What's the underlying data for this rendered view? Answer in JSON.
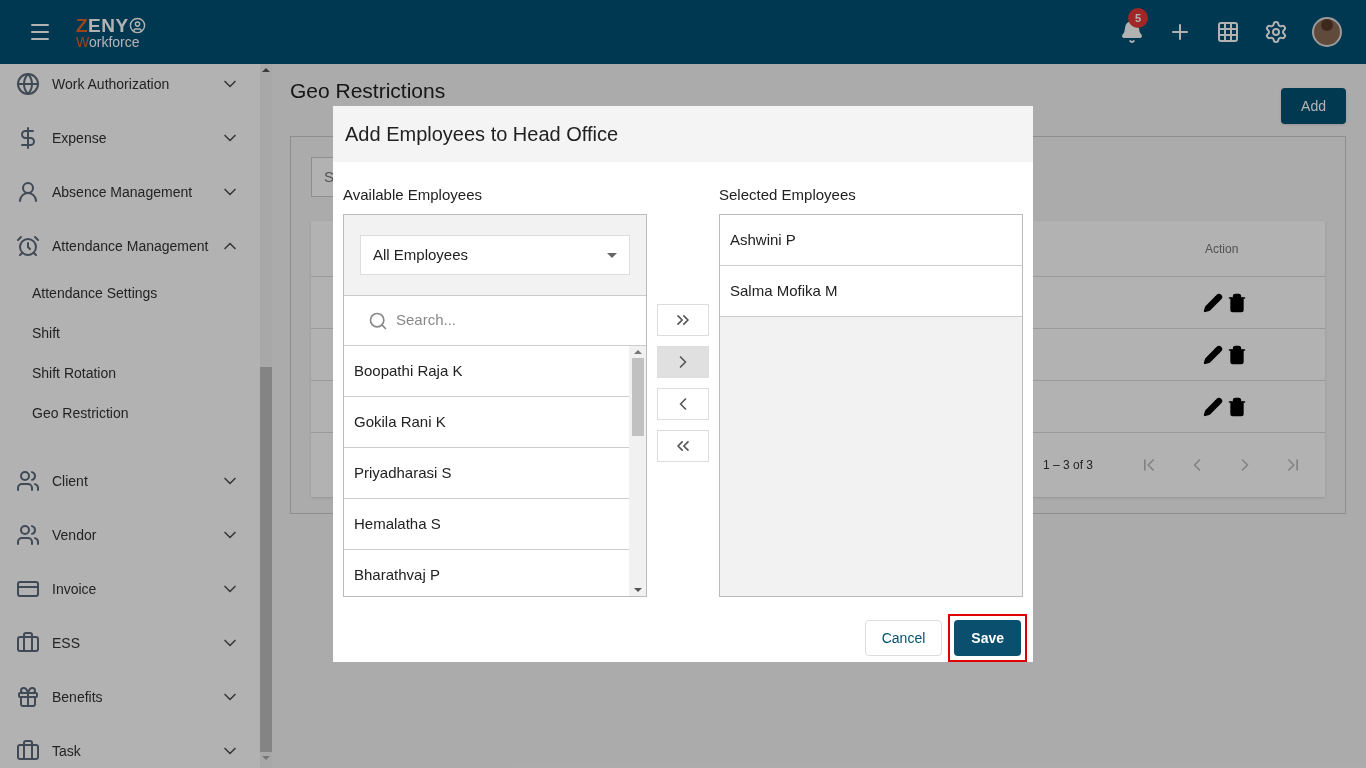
{
  "header": {
    "logo": {
      "mark": "ZENY",
      "sub": "Workforce"
    },
    "notifications": {
      "count": "5"
    }
  },
  "sidebar": {
    "items": [
      {
        "label": "Work Authorization",
        "expanded": false
      },
      {
        "label": "Expense",
        "expanded": false
      },
      {
        "label": "Absence Management",
        "expanded": false
      },
      {
        "label": "Attendance Management",
        "expanded": true,
        "children": [
          {
            "label": "Attendance Settings"
          },
          {
            "label": "Shift"
          },
          {
            "label": "Shift Rotation"
          },
          {
            "label": "Geo Restriction"
          }
        ]
      },
      {
        "label": "Client",
        "expanded": false
      },
      {
        "label": "Vendor",
        "expanded": false
      },
      {
        "label": "Invoice",
        "expanded": false
      },
      {
        "label": "ESS",
        "expanded": false
      },
      {
        "label": "Benefits",
        "expanded": false
      },
      {
        "label": "Task",
        "expanded": false
      }
    ]
  },
  "page": {
    "title": "Geo Restrictions",
    "add_button": "Add",
    "search": {
      "placeholder": "S"
    },
    "table": {
      "columns": [
        "Action"
      ],
      "rows": [
        {
          "editable": true,
          "deletable": true
        },
        {
          "editable": true,
          "deletable": true
        },
        {
          "editable": true,
          "deletable": true
        }
      ],
      "range": "1 – 3 of 3"
    }
  },
  "dialog": {
    "title": "Add Employees to Head Office",
    "available": {
      "label": "Available Employees",
      "filter": "All Employees",
      "search": {
        "placeholder": "Search..."
      },
      "items": [
        "Boopathi Raja K",
        "Gokila Rani K",
        "Priyadharasi S",
        "Hemalatha S",
        "Bharathvaj P"
      ]
    },
    "transfer_buttons": [
      {
        "kind": "move-all-right",
        "highlighted": false
      },
      {
        "kind": "move-right",
        "highlighted": true
      },
      {
        "kind": "move-left",
        "highlighted": false
      },
      {
        "kind": "move-all-left",
        "highlighted": false
      }
    ],
    "selected": {
      "label": "Selected Employees",
      "items": [
        "Ashwini P",
        "Salma Mofika M"
      ]
    },
    "buttons": {
      "cancel": "Cancel",
      "save": "Save"
    },
    "save_highlighted": true
  }
}
